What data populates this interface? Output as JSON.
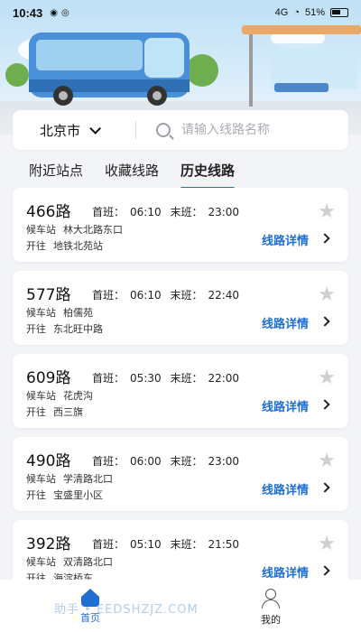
{
  "status_bar": {
    "time": "10:43",
    "battery": "51%",
    "network": "4G"
  },
  "search": {
    "city": "北京市",
    "placeholder": "请输入线路名称"
  },
  "tabs": [
    {
      "label": "附近站点",
      "active": false
    },
    {
      "label": "收藏线路",
      "active": false
    },
    {
      "label": "历史线路",
      "active": true
    }
  ],
  "labels": {
    "first": "首班：",
    "last": "末班：",
    "stop": "候车站",
    "toward": "开往",
    "detail": "线路详情"
  },
  "routes": [
    {
      "name": "466路",
      "first": "06:10",
      "last": "23:00",
      "stop": "林大北路东口",
      "toward": "地铁北苑站"
    },
    {
      "name": "577路",
      "first": "06:10",
      "last": "22:40",
      "stop": "柏儒苑",
      "toward": "东北旺中路"
    },
    {
      "name": "609路",
      "first": "05:30",
      "last": "22:00",
      "stop": "花虎沟",
      "toward": "西三旗"
    },
    {
      "name": "490路",
      "first": "06:00",
      "last": "23:00",
      "stop": "学清路北口",
      "toward": "宝盛里小区"
    },
    {
      "name": "392路",
      "first": "05:10",
      "last": "21:50",
      "stop": "双清路北口",
      "toward": "海淀桥东"
    }
  ],
  "bottom_nav": [
    {
      "label": "首页",
      "icon": "home-icon",
      "active": true
    },
    {
      "label": "我的",
      "icon": "user-icon",
      "active": false
    }
  ],
  "watermark": "助手 • EEDSHZJZ.COM",
  "colors": {
    "accent": "#1f6fd1",
    "background": "#f2f4f7",
    "star": "#cfcfcf"
  }
}
